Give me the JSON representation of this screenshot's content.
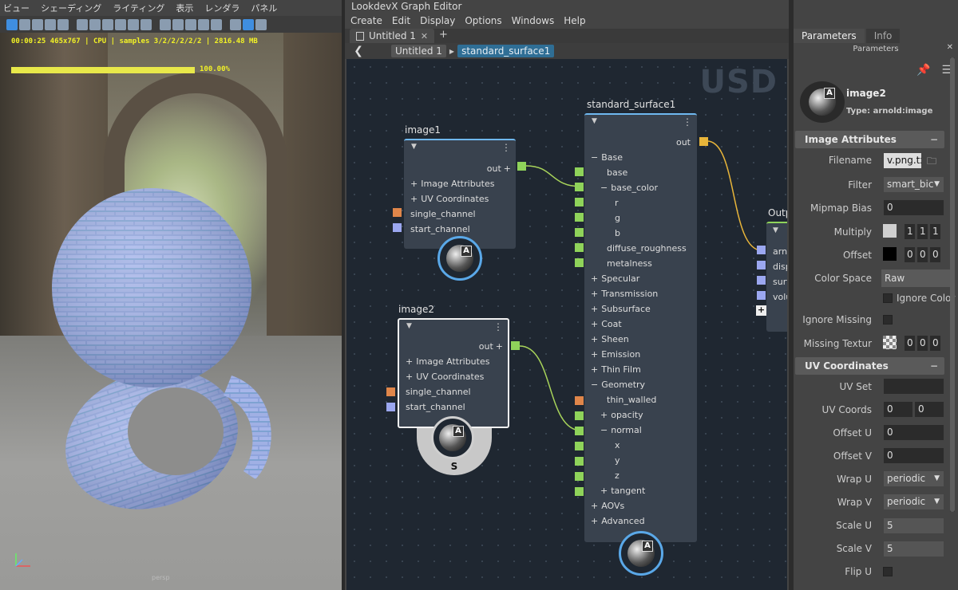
{
  "viewport": {
    "menu": [
      "ビュー",
      "シェーディング",
      "ライティング",
      "表示",
      "レンダラ",
      "パネル"
    ],
    "hud_text": "00:00:25 465x767 | CPU | samples 3/2/2/2/2/2 | 2816.48 MB",
    "progress": 1.0,
    "progress_label": "100.00%",
    "camera": "persp"
  },
  "graph_editor": {
    "title": "LookdevX Graph Editor",
    "menu": [
      "Create",
      "Edit",
      "Display",
      "Options",
      "Windows",
      "Help"
    ],
    "tab_label": "Untitled 1",
    "tab_add": "+",
    "breadcrumb": [
      "Untitled 1",
      "standard_surface1"
    ],
    "usd_label": "USD",
    "nodes": {
      "image1": {
        "title": "image1",
        "out": "out",
        "rows": [
          "Image Attributes",
          "UV Coordinates",
          "single_channel",
          "start_channel"
        ]
      },
      "image2": {
        "title": "image2",
        "out": "out",
        "rows": [
          "Image Attributes",
          "UV Coordinates",
          "single_channel",
          "start_channel"
        ],
        "badge_letter": "S"
      },
      "standard_surface1": {
        "title": "standard_surface1",
        "out": "out",
        "rows": [
          "Base",
          "base",
          "base_color",
          "r",
          "g",
          "b",
          "diffuse_roughness",
          "metalness",
          "Specular",
          "Transmission",
          "Subsurface",
          "Coat",
          "Sheen",
          "Emission",
          "Thin Film",
          "Geometry",
          "thin_walled",
          "opacity",
          "normal",
          "x",
          "y",
          "z",
          "tangent",
          "AOVs",
          "Advanced"
        ]
      },
      "output": {
        "title": "Outp",
        "rows": [
          "arnold",
          "displacement",
          "surface",
          "volume"
        ]
      }
    },
    "ball_letter": "A"
  },
  "parameters": {
    "tabs": [
      "Parameters",
      "Info"
    ],
    "header": "Parameters",
    "node_name": "image2",
    "node_type": "Type: arnold:image",
    "image_attributes": {
      "title": "Image Attributes",
      "filename_label": "Filename",
      "filename": "v.png.tx",
      "filter_label": "Filter",
      "filter": "smart_bic",
      "mipmap_label": "Mipmap Bias",
      "mipmap": "0",
      "multiply_label": "Multiply",
      "multiply": [
        "1",
        "1",
        "1"
      ],
      "offset_label": "Offset",
      "offset": [
        "0",
        "0",
        "0"
      ],
      "colorspace_label": "Color Space",
      "colorspace": "Raw",
      "ignore_color_label": "Ignore Color",
      "ignore_missing_label": "Ignore Missing",
      "missing_texture_label": "Missing Textur",
      "missing_texture": [
        "0",
        "0",
        "0"
      ]
    },
    "uv_coordinates": {
      "title": "UV Coordinates",
      "uv_set_label": "UV Set",
      "uv_set": "",
      "uv_coords_label": "UV Coords",
      "uv_coords": [
        "0",
        "0"
      ],
      "offset_u_label": "Offset U",
      "offset_u": "0",
      "offset_v_label": "Offset V",
      "offset_v": "0",
      "wrap_u_label": "Wrap U",
      "wrap_u": "periodic",
      "wrap_v_label": "Wrap V",
      "wrap_v": "periodic",
      "scale_u_label": "Scale U",
      "scale_u": "5",
      "scale_v_label": "Scale V",
      "scale_v": "5",
      "flip_u_label": "Flip U"
    },
    "colors": {
      "accent": "#2f6e95",
      "node_top": "#6fb8f0"
    }
  }
}
